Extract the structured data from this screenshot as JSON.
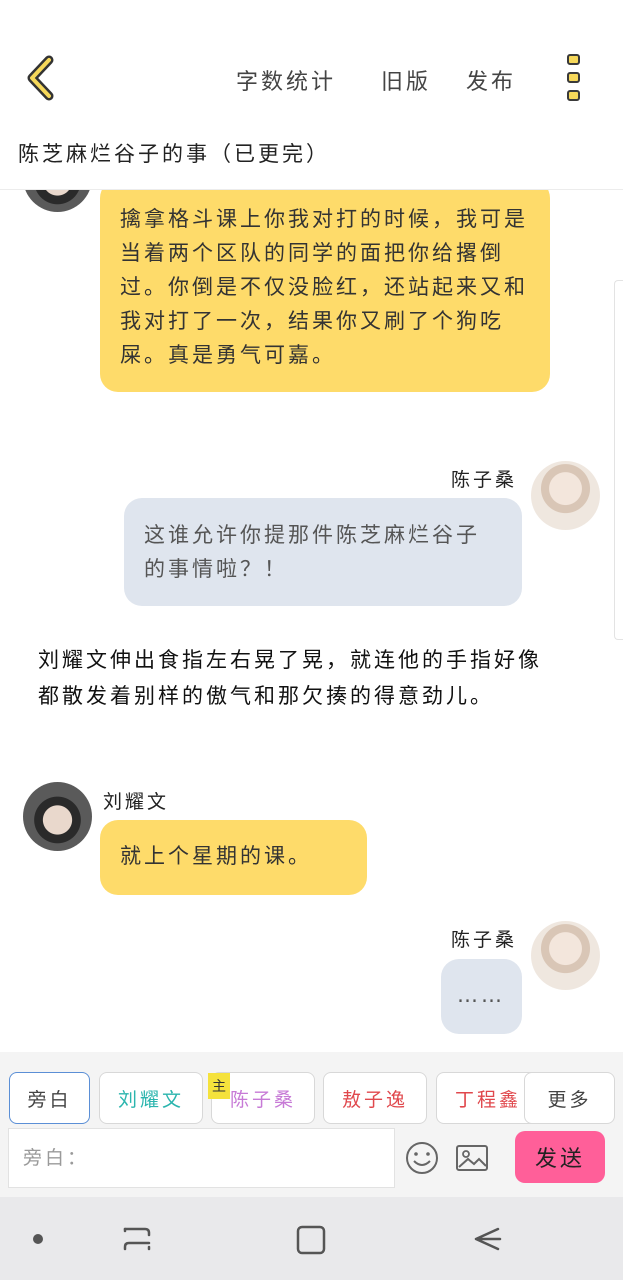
{
  "header": {
    "actions": [
      "字数统计",
      "旧版",
      "发布"
    ],
    "doc_title": "陈芝麻烂谷子的事（已更完）"
  },
  "messages": [
    {
      "type": "bubble",
      "speaker": "",
      "side": "left",
      "text": "擒拿格斗课上你我对打的时候，我可是当着两个区队的同学的面把你给撂倒过。你倒是不仅没脸红，还站起来又和我对打了一次，结果你又刷了个狗吃屎。真是勇气可嘉。"
    },
    {
      "type": "bubble",
      "speaker": "陈子桑",
      "side": "right",
      "text": "这谁允许你提那件陈芝麻烂谷子的事情啦？！"
    },
    {
      "type": "narration",
      "text": "刘耀文伸出食指左右晃了晃，就连他的手指好像都散发着别样的傲气和那欠揍的得意劲儿。"
    },
    {
      "type": "bubble",
      "speaker": "刘耀文",
      "side": "left",
      "text": "就上个星期的课。"
    },
    {
      "type": "bubble",
      "speaker": "陈子桑",
      "side": "right",
      "text": "……"
    }
  ],
  "roles": [
    {
      "label": "旁白",
      "color": "#444444",
      "active": true
    },
    {
      "label": "刘耀文",
      "color": "#2bb5ae",
      "active": false
    },
    {
      "label": "陈子桑",
      "color": "#c77ad6",
      "active": false,
      "badge": "主"
    },
    {
      "label": "敖子逸",
      "color": "#e0484d",
      "active": false
    },
    {
      "label": "丁程鑫",
      "color": "#e0484d",
      "active": false
    },
    {
      "label": "更多",
      "color": "#444444",
      "active": false
    }
  ],
  "composer": {
    "placeholder": "旁白：",
    "value": "",
    "send_label": "发送",
    "icons": [
      "emoji-icon",
      "image-icon"
    ]
  },
  "colors": {
    "accent_yellow": "#fedb6a",
    "bubble_blue": "#dfe5ee",
    "send_pink": "#ff5f99"
  }
}
